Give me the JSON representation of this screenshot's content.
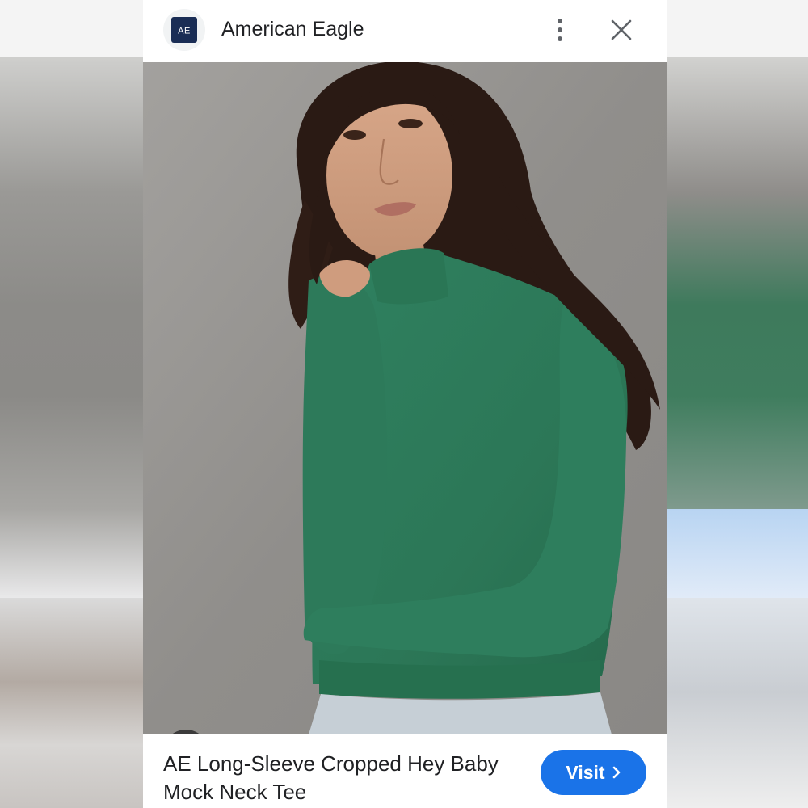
{
  "header": {
    "logo_text": "AE",
    "brand_name": "American Eagle",
    "menu_icon": "more-vert-icon",
    "close_icon": "close-icon"
  },
  "image": {
    "description_icon": "product-photo",
    "lens_icon": "lens-search-icon"
  },
  "product": {
    "title": "AE Long-Sleeve Cropped Hey Baby Mock Neck Tee",
    "visit_label": "Visit",
    "visit_icon": "chevron-right-icon"
  },
  "colors": {
    "accent": "#1a73e8",
    "logo_bg": "#1a2d55",
    "sweater": "#2e7a58",
    "backdrop": "#959390"
  }
}
